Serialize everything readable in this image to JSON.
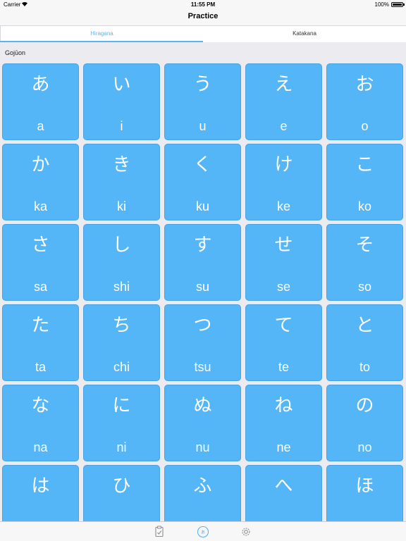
{
  "status_bar": {
    "carrier": "Carrier",
    "time": "11:55 PM",
    "battery": "100%"
  },
  "nav": {
    "title": "Practice"
  },
  "tabs": [
    {
      "label": "Hiragana",
      "active": true
    },
    {
      "label": "Katakana",
      "active": false
    }
  ],
  "section": {
    "title": "Gojūon"
  },
  "kana": [
    [
      {
        "kana": "あ",
        "romaji": "a"
      },
      {
        "kana": "い",
        "romaji": "i"
      },
      {
        "kana": "う",
        "romaji": "u"
      },
      {
        "kana": "え",
        "romaji": "e"
      },
      {
        "kana": "お",
        "romaji": "o"
      }
    ],
    [
      {
        "kana": "か",
        "romaji": "ka"
      },
      {
        "kana": "き",
        "romaji": "ki"
      },
      {
        "kana": "く",
        "romaji": "ku"
      },
      {
        "kana": "け",
        "romaji": "ke"
      },
      {
        "kana": "こ",
        "romaji": "ko"
      }
    ],
    [
      {
        "kana": "さ",
        "romaji": "sa"
      },
      {
        "kana": "し",
        "romaji": "shi"
      },
      {
        "kana": "す",
        "romaji": "su"
      },
      {
        "kana": "せ",
        "romaji": "se"
      },
      {
        "kana": "そ",
        "romaji": "so"
      }
    ],
    [
      {
        "kana": "た",
        "romaji": "ta"
      },
      {
        "kana": "ち",
        "romaji": "chi"
      },
      {
        "kana": "つ",
        "romaji": "tsu"
      },
      {
        "kana": "て",
        "romaji": "te"
      },
      {
        "kana": "と",
        "romaji": "to"
      }
    ],
    [
      {
        "kana": "な",
        "romaji": "na"
      },
      {
        "kana": "に",
        "romaji": "ni"
      },
      {
        "kana": "ぬ",
        "romaji": "nu"
      },
      {
        "kana": "ね",
        "romaji": "ne"
      },
      {
        "kana": "の",
        "romaji": "no"
      }
    ],
    [
      {
        "kana": "は",
        "romaji": ""
      },
      {
        "kana": "ひ",
        "romaji": ""
      },
      {
        "kana": "ふ",
        "romaji": ""
      },
      {
        "kana": "へ",
        "romaji": ""
      },
      {
        "kana": "ほ",
        "romaji": ""
      }
    ]
  ],
  "tab_bar": [
    {
      "icon": "clipboard-icon",
      "active": false
    },
    {
      "icon": "practice-icon",
      "active": true
    },
    {
      "icon": "gear-icon",
      "active": false
    }
  ],
  "colors": {
    "accent": "#5ab4f0",
    "tile": "#54b6f7",
    "inactive_icon": "#8e8e93"
  }
}
